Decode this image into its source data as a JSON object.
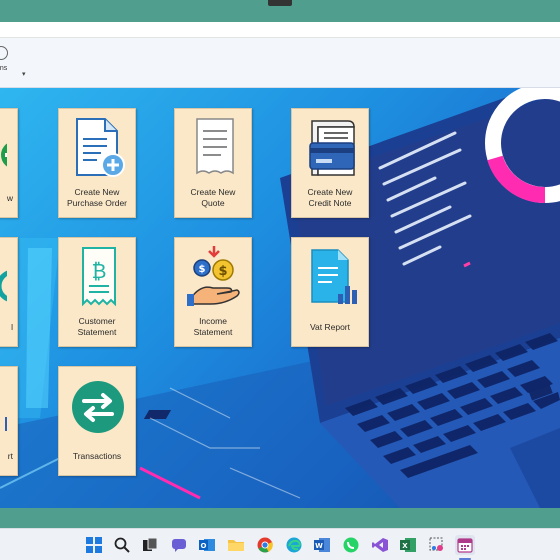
{
  "ribbon": {
    "partial_label": "ons"
  },
  "tiles": {
    "t0a": {
      "label": "w"
    },
    "t1a": {
      "label_line1": "Create New",
      "label_line2": "Purchase Order"
    },
    "t2a": {
      "label_line1": "Create New",
      "label_line2": "Quote"
    },
    "t3a": {
      "label_line1": "Create New",
      "label_line2": "Credit Note"
    },
    "t0b": {
      "label": "l"
    },
    "t1b": {
      "label_line1": "Customer",
      "label_line2": "Statement"
    },
    "t2b": {
      "label_line1": "Income",
      "label_line2": "Statement"
    },
    "t3b": {
      "label": "Vat Report"
    },
    "t0c": {
      "label": "rt"
    },
    "t1c": {
      "label": "Transactions"
    }
  },
  "icons": {
    "purchase_order": "document-add-icon",
    "quote": "receipt-icon",
    "credit_note": "credit-card-receipt-icon",
    "customer_statement": "bitcoin-receipt-icon",
    "income_statement": "money-hand-icon",
    "vat_report": "report-chart-icon",
    "transactions": "exchange-arrows-icon"
  },
  "taskbar": {
    "icons": [
      "windows-start-icon",
      "search-icon",
      "task-view-icon",
      "chat-icon",
      "outlook-icon",
      "file-explorer-icon",
      "chrome-icon",
      "edge-icon",
      "word-icon",
      "whatsapp-icon",
      "visual-studio-icon",
      "excel-icon",
      "snipping-tool-icon",
      "calendar-app-icon"
    ]
  },
  "colors": {
    "tile_bg": "#fbe8c8",
    "frame_teal": "#4f9e8e",
    "desktop_blue": "#1e8fe0"
  }
}
